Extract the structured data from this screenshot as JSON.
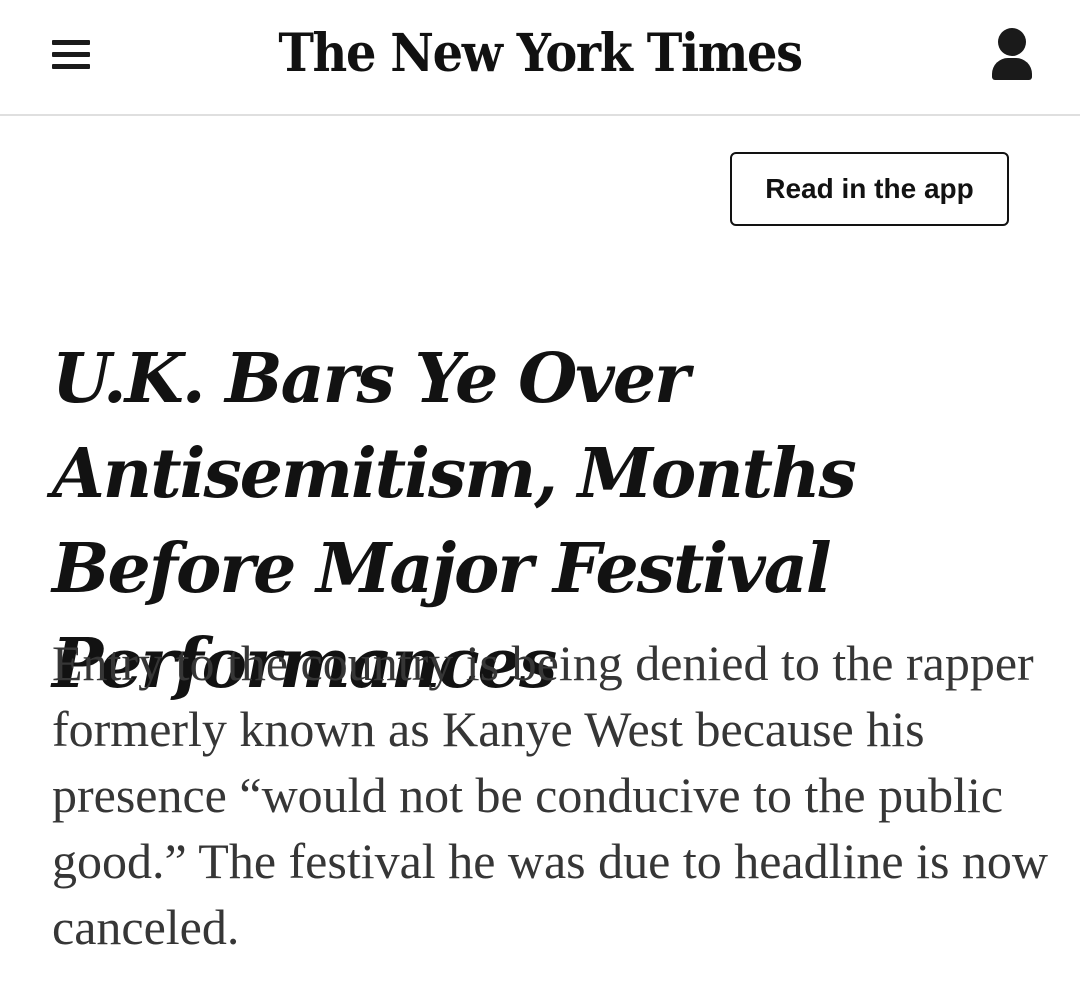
{
  "header": {
    "logo_text": "The New York Times",
    "menu_icon": "hamburger-menu-icon",
    "account_icon": "user-account-icon"
  },
  "cta": {
    "app_button_label": "Read in the app"
  },
  "article": {
    "headline": "U.K. Bars Ye Over Antisemitism, Months Before Major Festival Performances",
    "summary": "Entry to the country is being denied to the rapper formerly known as Kanye West because his presence “would not be conducive to the public good.” The festival he was due to headline is now canceled."
  },
  "colors": {
    "text": "#121212",
    "summary_text": "#363636",
    "divider": "#dfdfdf",
    "background": "#ffffff"
  }
}
